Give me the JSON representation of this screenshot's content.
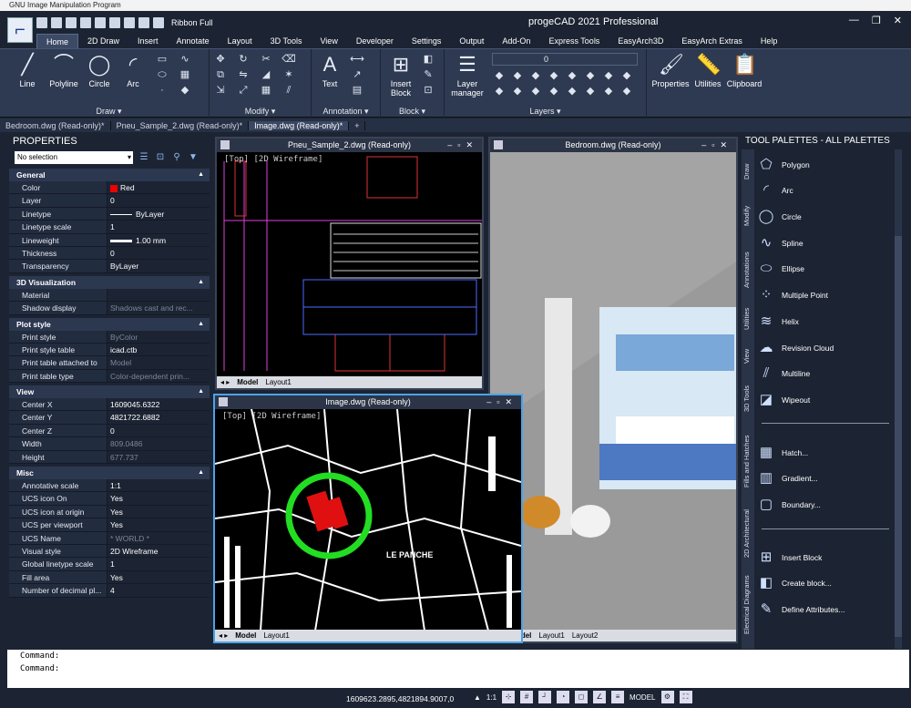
{
  "window": {
    "outer_title": "GNU Image Manipulation Program",
    "app_title": "progeCAD 2021 Professional"
  },
  "qat": {
    "ribbon_mode": "Ribbon Full"
  },
  "ribbon_tabs": [
    "Home",
    "2D Draw",
    "Insert",
    "Annotate",
    "Layout",
    "3D Tools",
    "View",
    "Developer",
    "Settings",
    "Output",
    "Add-On",
    "Express Tools",
    "EasyArch3D",
    "EasyArch Extras",
    "Help"
  ],
  "ribbon": {
    "draw": {
      "label": "Draw ▾",
      "buttons": [
        "Line",
        "Polyline",
        "Circle",
        "Arc"
      ]
    },
    "modify": {
      "label": "Modify ▾"
    },
    "annotation": {
      "label": "Annotation ▾",
      "buttons": [
        "Text"
      ]
    },
    "block": {
      "label": "Block ▾",
      "buttons": [
        "Insert Block"
      ]
    },
    "layers": {
      "label": "Layers ▾",
      "buttons": [
        "Layer manager"
      ],
      "current_layer": "0"
    },
    "right_buttons": [
      "Properties",
      "Utilities",
      "Clipboard"
    ]
  },
  "doc_tabs": [
    "Bedroom.dwg (Read-only)*",
    "Pneu_Sample_2.dwg (Read-only)*",
    "Image.dwg (Read-only)*"
  ],
  "properties": {
    "title": "PROPERTIES",
    "selection": "No selection",
    "sections": [
      {
        "name": "General",
        "rows": [
          [
            "Color",
            "Red"
          ],
          [
            "Layer",
            "0"
          ],
          [
            "Linetype",
            "ByLayer"
          ],
          [
            "Linetype scale",
            "1"
          ],
          [
            "Lineweight",
            "1.00 mm"
          ],
          [
            "Thickness",
            "0"
          ],
          [
            "Transparency",
            "ByLayer"
          ]
        ]
      },
      {
        "name": "3D Visualization",
        "rows": [
          [
            "Material",
            ""
          ],
          [
            "Shadow display",
            "Shadows cast and rec..."
          ]
        ]
      },
      {
        "name": "Plot style",
        "rows": [
          [
            "Print style",
            "ByColor"
          ],
          [
            "Print style table",
            "icad.ctb"
          ],
          [
            "Print table attached to",
            "Model"
          ],
          [
            "Print table type",
            "Color-dependent prin..."
          ]
        ]
      },
      {
        "name": "View",
        "rows": [
          [
            "Center X",
            "1609045.6322"
          ],
          [
            "Center Y",
            "4821722.6882"
          ],
          [
            "Center Z",
            "0"
          ],
          [
            "Width",
            "809.0486"
          ],
          [
            "Height",
            "677.737"
          ]
        ]
      },
      {
        "name": "Misc",
        "rows": [
          [
            "Annotative scale",
            "1:1"
          ],
          [
            "UCS icon On",
            "Yes"
          ],
          [
            "UCS icon at origin",
            "Yes"
          ],
          [
            "UCS per viewport",
            "Yes"
          ],
          [
            "UCS Name",
            "* WORLD *"
          ],
          [
            "Visual style",
            "2D Wireframe"
          ],
          [
            "Global linetype scale",
            "1"
          ],
          [
            "Fill area",
            "Yes"
          ],
          [
            "Number of decimal pl...",
            "4"
          ]
        ]
      }
    ]
  },
  "viewports": {
    "pneu": {
      "title": "Pneu_Sample_2.dwg (Read-only)",
      "label": "[Top] [2D Wireframe]",
      "tabs": [
        "Model",
        "Layout1"
      ]
    },
    "bedroom": {
      "title": "Bedroom.dwg (Read-only)",
      "tabs": [
        "Model",
        "Layout1",
        "Layout2"
      ]
    },
    "image": {
      "title": "Image.dwg (Read-only)",
      "label": "[Top] [2D Wireframe]",
      "tabs": [
        "Model",
        "Layout1"
      ],
      "map_text": "LE PANCHE"
    }
  },
  "tool_palettes": {
    "title": "TOOL PALETTES - ALL PALETTES",
    "side_tabs": [
      "Draw",
      "Modify",
      "Annotations",
      "Utilities",
      "View",
      "3D Tools",
      "Fills and Hatches",
      "2D Architectural",
      "Electrical Diagrams"
    ],
    "items": [
      "Polygon",
      "Arc",
      "Circle",
      "Spline",
      "Ellipse",
      "Multiple Point",
      "Helix",
      "Revision Cloud",
      "Multiline",
      "Wipeout",
      "Hatch...",
      "Gradient...",
      "Boundary...",
      "Insert Block",
      "Create block...",
      "Define Attributes..."
    ]
  },
  "command": {
    "line1": "Command:",
    "line2": "Command:"
  },
  "status": {
    "coords": "1609623.2895,4821894.9007,0",
    "scale": "1:1",
    "model": "MODEL"
  }
}
